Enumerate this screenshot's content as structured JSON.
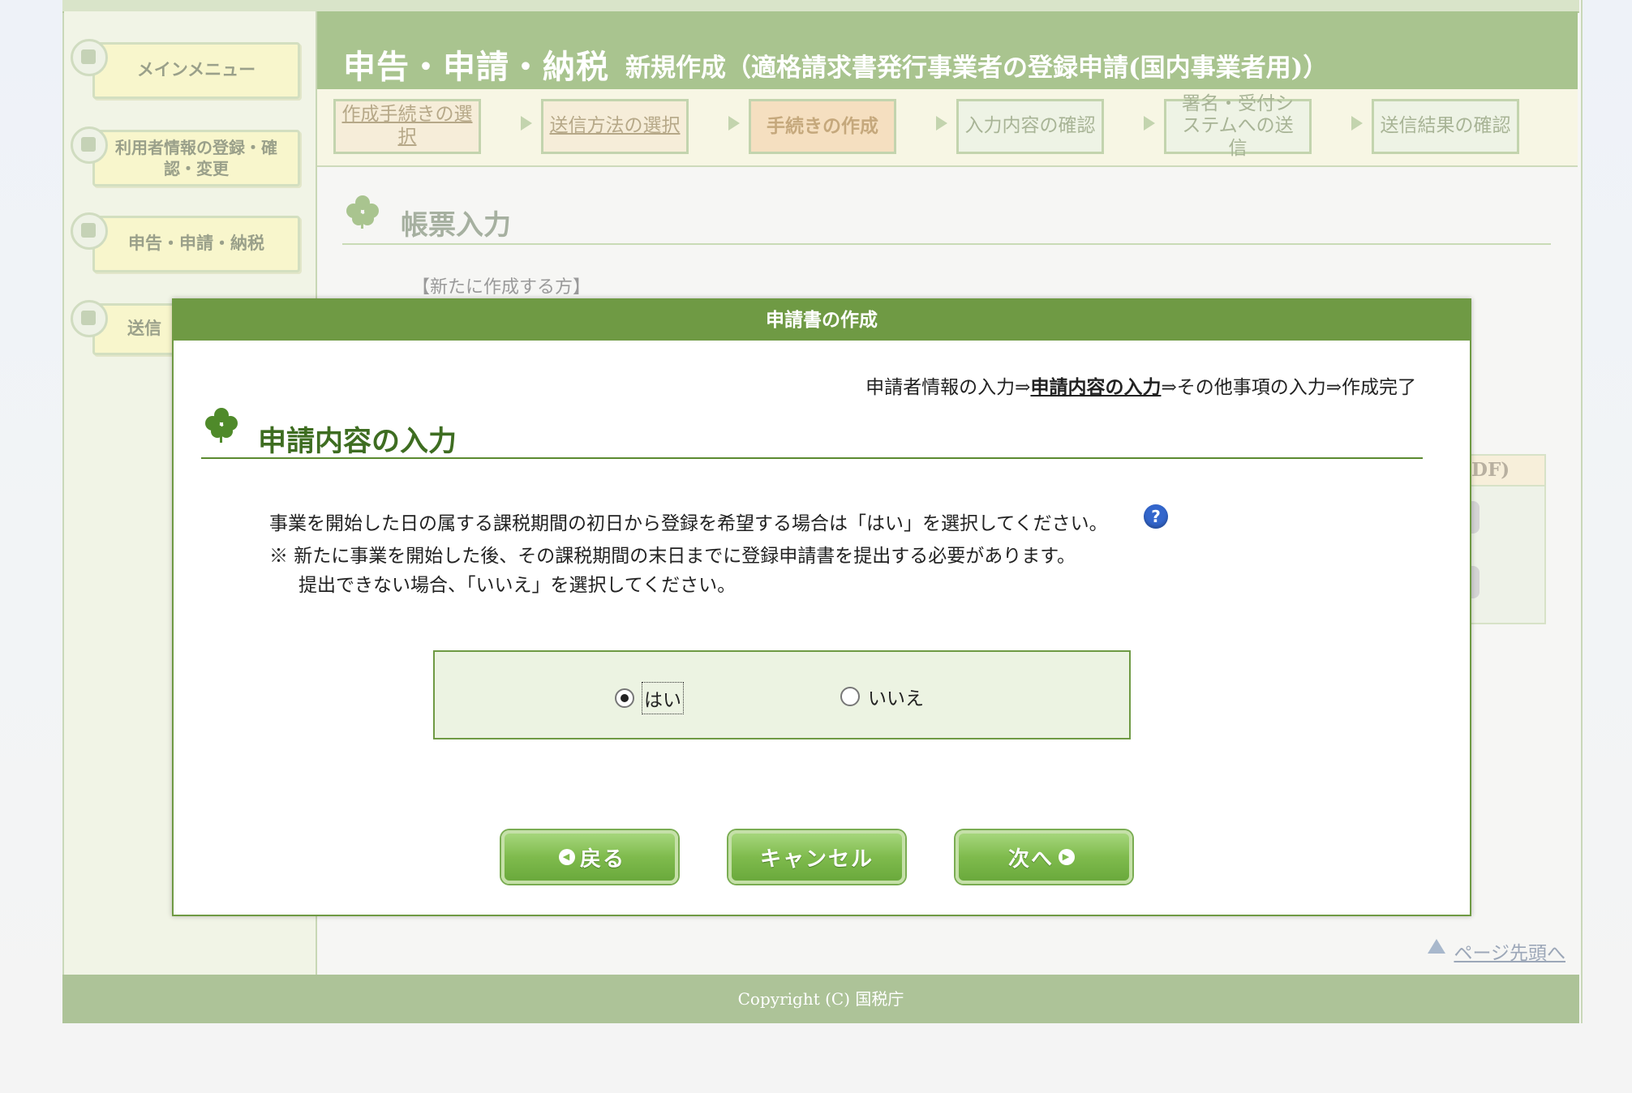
{
  "sidebar": {
    "items": [
      {
        "label": "メインメニュー"
      },
      {
        "label": "利用者情報の登録・確認・変更"
      },
      {
        "label": "申告・申請・納税"
      },
      {
        "label": "送信"
      }
    ]
  },
  "header": {
    "title": "申告・申請・納税",
    "subtitle": "新規作成（適格請求書発行事業者の登録申請(国内事業者用)）"
  },
  "steps": [
    {
      "label": "作成手続きの選択"
    },
    {
      "label": "送信方法の選択"
    },
    {
      "label": "手続きの作成"
    },
    {
      "label": "入力内容の確認"
    },
    {
      "label": "署名・受付システムへの送信"
    },
    {
      "label": "送信結果の確認"
    }
  ],
  "main": {
    "section_title": "帳票入力",
    "new_label": "【新たに作成する方】",
    "right_panel_header": "DF)"
  },
  "modal": {
    "title": "申請書の作成",
    "crumb_prefix": "申請者情報の入力⇒",
    "crumb_current": "申請内容の入力",
    "crumb_suffix": "⇒その他事項の入力⇒作成完了",
    "heading": "申請内容の入力",
    "question": "事業を開始した日の属する課税期間の初日から登録を希望する場合は「はい」を選択してください。",
    "note_line1": "※ 新たに事業を開始した後、その課税期間の末日までに登録申請書を提出する必要があります。",
    "note_line2": "提出できない場合、「いいえ」を選択してください。",
    "options": [
      {
        "label": "はい",
        "selected": true
      },
      {
        "label": "いいえ",
        "selected": false
      }
    ],
    "buttons": {
      "back": "戻る",
      "cancel": "キャンセル",
      "next": "次へ"
    }
  },
  "page_top_link": "ページ先頭へ",
  "footer": "Copyright (C) 国税庁",
  "colors": {
    "accent_green": "#6f9a44",
    "heading_green": "#3e6d21",
    "button_green": "#7fbb4d"
  }
}
